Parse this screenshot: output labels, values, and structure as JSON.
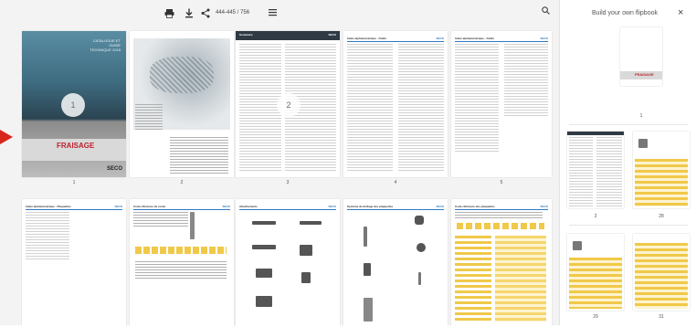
{
  "toolbar": {
    "print_icon": "printer-icon",
    "download_icon": "download-icon",
    "share_icon": "share-icon",
    "pages": "444-445 / 756",
    "menu_icon": "menu-icon"
  },
  "search": {
    "icon": "search-icon"
  },
  "colors": {
    "accent_arrow": "#d9261c",
    "brand_red": "#c0202a",
    "header_blue": "#2f7ac4"
  },
  "pages": [
    {
      "number": "1",
      "marker": "1",
      "brand": "FRAISAGE",
      "logo": "SECO",
      "cover_title": "CATALOGUE ET GUIDE TECHNIQUE 2018"
    },
    {
      "number": "2"
    },
    {
      "number": "3",
      "marker": "2",
      "header": "Sommaire",
      "header_right": "SECO"
    },
    {
      "number": "4",
      "header": "Index alphanumérique - Outils",
      "header_right": "SECO"
    },
    {
      "number": "5",
      "header": "Index alphanumérique - Outils",
      "header_right": "SECO"
    },
    {
      "number": "",
      "header": "Index alphanumérique - Plaquettes",
      "header_right": "SECO"
    },
    {
      "number": "",
      "header": "Code référence de corde",
      "header_right": "SECO"
    },
    {
      "number": "",
      "header": "Attachements",
      "header_right": "SECO"
    },
    {
      "number": "",
      "header": "Système de bridage des plaquettes",
      "header_right": "SECO"
    },
    {
      "number": "",
      "header": "Code référence des plaquettes",
      "header_right": "SECO"
    }
  ],
  "sidebar": {
    "title": "Build your own flipbook",
    "close_icon": "close-icon",
    "thumbs": [
      {
        "label": "1"
      },
      {
        "label": "3"
      },
      {
        "label": "28"
      },
      {
        "label": "29"
      },
      {
        "label": "31"
      }
    ]
  }
}
